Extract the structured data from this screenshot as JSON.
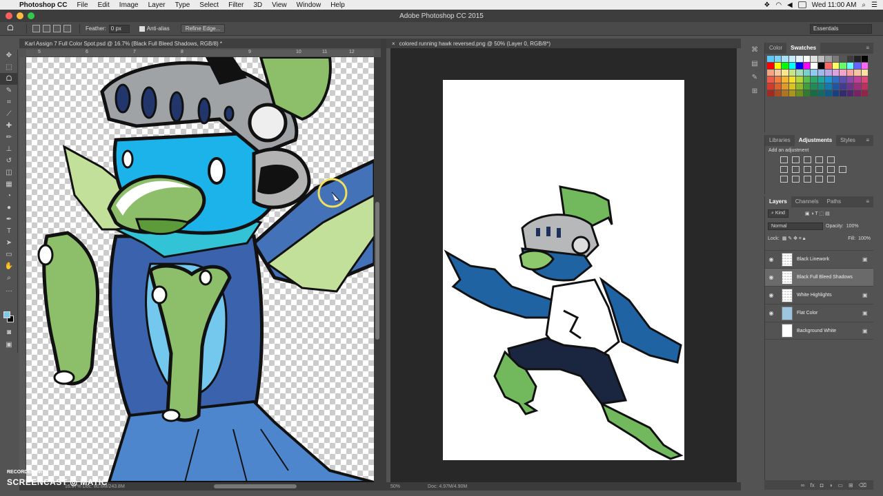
{
  "menubar": {
    "app": "Photoshop CC",
    "items": [
      "File",
      "Edit",
      "Image",
      "Layer",
      "Type",
      "Select",
      "Filter",
      "3D",
      "View",
      "Window",
      "Help"
    ],
    "clock": "Wed 11:00 AM"
  },
  "window": {
    "title": "Adobe Photoshop CC 2015"
  },
  "options": {
    "feather_label": "Feather:",
    "feather_value": "0 px",
    "antialias_label": "Anti-alias",
    "refine_edge": "Refine Edge...",
    "workspace": "Essentials"
  },
  "documents": {
    "left_tab": "Karl Assign 7 Full Color Spot.psd @ 16.7% (Black Full Bleed Shadows, RGB/8) *",
    "right_tab": "colored running hawk reversed.png @ 50% (Layer 0, RGB/8*)",
    "left_status": "16.67%  Doc: 80.6M/243.8M",
    "right_zoom": "50%",
    "right_doc": "Doc: 4.97M/4.90M",
    "ruler_ticks": [
      "5",
      "6",
      "7",
      "8",
      "9",
      "10",
      "11",
      "12"
    ]
  },
  "panels": {
    "color_tabs": [
      "Color",
      "Swatches"
    ],
    "adjust_tabs": [
      "Libraries",
      "Adjustments",
      "Styles"
    ],
    "add_adjustment": "Add an adjustment",
    "layers_tabs": [
      "Layers",
      "Channels",
      "Paths"
    ],
    "kind": "Kind",
    "blend_mode": "Normal",
    "opacity_label": "Opacity:",
    "opacity_value": "100%",
    "lock_label": "Lock:",
    "fill_label": "Fill:",
    "fill_value": "100%",
    "layers": [
      {
        "name": "Black Linework",
        "visible": true,
        "locked": true
      },
      {
        "name": "Black Full Bleed Shadows",
        "visible": true,
        "locked": false,
        "selected": true
      },
      {
        "name": "White Highlights",
        "visible": true,
        "locked": true
      },
      {
        "name": "Flat Color",
        "visible": true,
        "locked": true
      },
      {
        "name": "Background White",
        "visible": false,
        "locked": true
      }
    ]
  },
  "swatch_colors": [
    "#5bc8f5",
    "#7ad3f7",
    "#a6e0f9",
    "#c7ecfb",
    "#e3f5fd",
    "#ffffff",
    "#e0e0e0",
    "#bdbdbd",
    "#9e9e9e",
    "#7a7a7a",
    "#565656",
    "#3c3c3c",
    "#222222",
    "#000000",
    "#ff0000",
    "#ffff00",
    "#00ff00",
    "#00ffff",
    "#0000ff",
    "#ff00ff",
    "#ffffff",
    "#000000",
    "#ff6666",
    "#ffff66",
    "#66ff66",
    "#66ffff",
    "#6666ff",
    "#ff66ff",
    "#f4a582",
    "#f7c59f",
    "#fde68a",
    "#c6e58b",
    "#a8ddb5",
    "#7ccfd1",
    "#8ec9f0",
    "#9fb8ed",
    "#b9a7e8",
    "#dca3e0",
    "#f2a4c8",
    "#f5a3a3",
    "#f8c3a0",
    "#fbe1a3",
    "#ee5a4a",
    "#f27d3d",
    "#f6b42e",
    "#f3e02a",
    "#b6d53a",
    "#58bd4a",
    "#2aa66b",
    "#20a6a0",
    "#1e95d0",
    "#2d6fc7",
    "#5b4fb6",
    "#8d47ad",
    "#c0409a",
    "#e0457a",
    "#d23b2c",
    "#d9632a",
    "#e1992a",
    "#d9c41f",
    "#8fb72b",
    "#3ea03a",
    "#1f8c57",
    "#17897f",
    "#1577ad",
    "#1f54a3",
    "#433a93",
    "#6d338d",
    "#9c2e7d",
    "#bd3061",
    "#a12a20",
    "#a94b1f",
    "#b0741f",
    "#a8961a",
    "#6d8d22",
    "#2f7c2d",
    "#176c43",
    "#126a62",
    "#105b86",
    "#183f7e",
    "#322b72",
    "#52266d",
    "#782361",
    "#90244a"
  ]
}
